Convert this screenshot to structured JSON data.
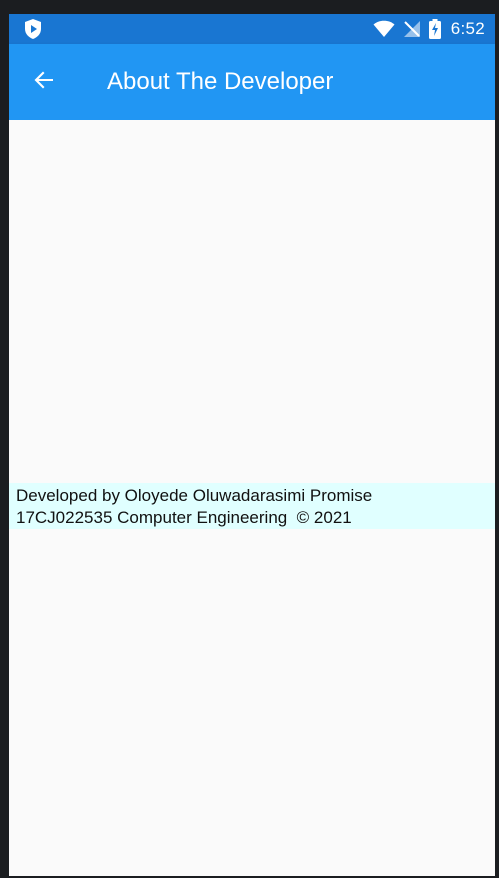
{
  "status_bar": {
    "time": "6:52",
    "icons": [
      "shield-play-icon",
      "wifi-icon",
      "no-signal-icon",
      "battery-charging-icon"
    ]
  },
  "app_bar": {
    "back_icon": "arrow-back-icon",
    "title": "About The Developer"
  },
  "content": {
    "line1": "Developed by Oloyede Oluwadarasimi Promise",
    "line2": "17CJ022535 Computer Engineering  © 2021"
  },
  "colors": {
    "status_bar": "#1976d2",
    "app_bar": "#2196f3",
    "content_bg": "#fafafa",
    "info_bg": "#e0ffff"
  }
}
